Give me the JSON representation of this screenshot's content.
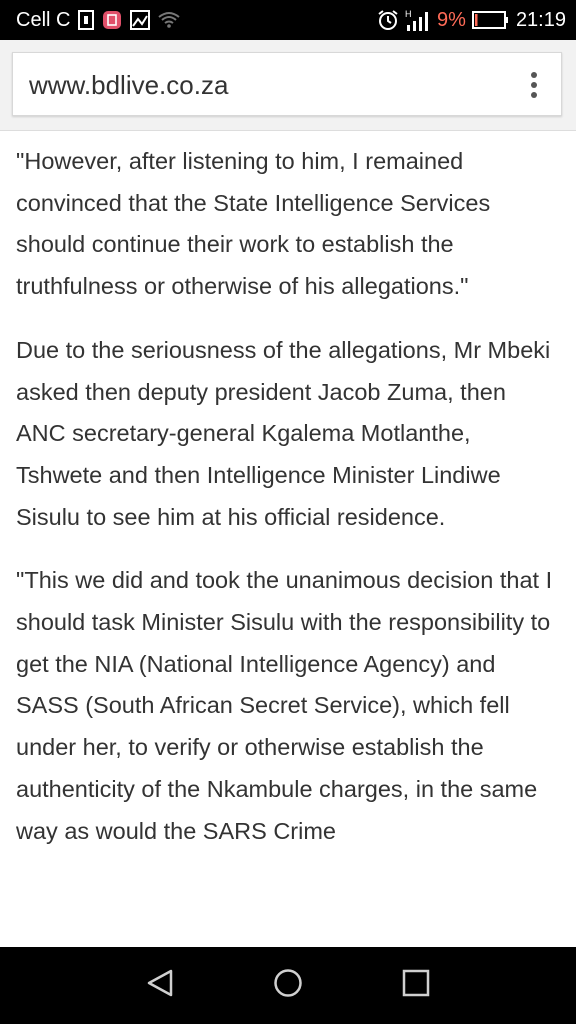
{
  "status_bar": {
    "carrier": "Cell C",
    "battery_percent": "9%",
    "time": "21:19",
    "icons": [
      "sim-card-icon",
      "notification-icon",
      "image-icon",
      "wifi-icon",
      "alarm-icon",
      "signal-icon",
      "battery-icon"
    ],
    "battery_level": 0.09
  },
  "browser": {
    "url": "www.bdlive.co.za"
  },
  "article": {
    "paragraphs": [
      "\"However, after listening to him, I remained convinced that the State Intelligence Services should continue their work to establish the truthfulness or otherwise of his allegations.\"",
      "Due to the seriousness of the allegations, Mr Mbeki asked then deputy president Jacob Zuma, then ANC secretary-general Kgalema Motlanthe, Tshwete and then Intelligence Minister Lindiwe Sisulu to see him at his official residence.",
      "\"This we did and took the unanimous decision that I should task Minister Sisulu with the responsibility to get the NIA (National Intelligence Agency) and SASS (South African Secret Service), which fell under her, to verify or otherwise establish the authenticity of the Nkambule charges, in the same way as would the SARS Crime"
    ]
  },
  "nav": {
    "buttons": [
      "back-icon",
      "home-icon",
      "recents-icon"
    ]
  }
}
